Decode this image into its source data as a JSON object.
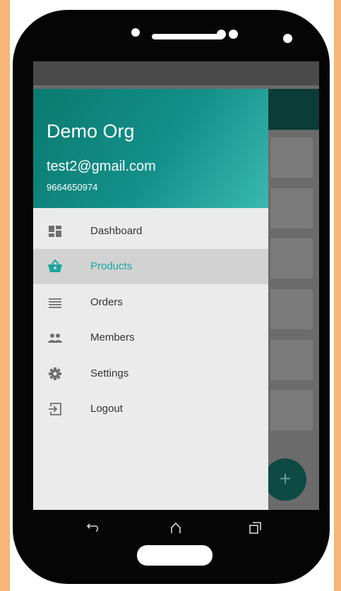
{
  "drawer": {
    "org_name": "Demo Org",
    "email": "test2@gmail.com",
    "phone": "9664650974",
    "items": [
      {
        "label": "Dashboard",
        "icon": "dashboard-icon",
        "active": false
      },
      {
        "label": "Products",
        "icon": "basket-icon",
        "active": true
      },
      {
        "label": "Orders",
        "icon": "list-icon",
        "active": false
      },
      {
        "label": "Members",
        "icon": "people-icon",
        "active": false
      },
      {
        "label": "Settings",
        "icon": "gear-icon",
        "active": false
      },
      {
        "label": "Logout",
        "icon": "logout-icon",
        "active": false
      }
    ]
  },
  "fab": {
    "label": "+"
  },
  "colors": {
    "accent": "#19a69e",
    "header_start": "#0a7a6f",
    "header_end": "#3ab9b0",
    "appbar": "#0b3c38",
    "page_background": "#f6b677"
  },
  "navbar": {
    "icons": [
      "back-icon",
      "home-icon",
      "recents-icon"
    ]
  }
}
